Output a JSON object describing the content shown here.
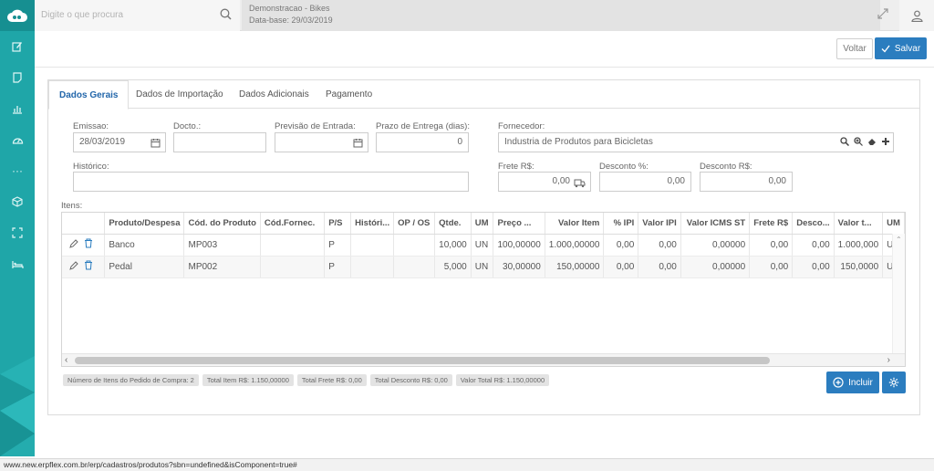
{
  "header": {
    "search_placeholder": "Digite o que procura",
    "company_name": "Demonstracao - Bikes",
    "base_date": "Data-base: 29/03/2019"
  },
  "sidebar": {
    "icons": [
      "edit-icon",
      "note-icon",
      "chart-icon",
      "dashboard-icon",
      "more-icon",
      "box-icon",
      "expand-icon",
      "bed-icon"
    ],
    "more_glyph": "···"
  },
  "actions": {
    "back_label": "Voltar",
    "save_label": "Salvar"
  },
  "tabs": [
    {
      "label": "Dados Gerais",
      "active": true
    },
    {
      "label": "Dados de Importação",
      "active": false
    },
    {
      "label": "Dados Adicionais",
      "active": false
    },
    {
      "label": "Pagamento",
      "active": false
    }
  ],
  "form": {
    "emissao_label": "Emissao:",
    "emissao_value": "28/03/2019",
    "docto_label": "Docto.:",
    "docto_value": "",
    "previsao_label": "Previsão de Entrada:",
    "previsao_value": "",
    "prazo_label": "Prazo de Entrega (dias):",
    "prazo_value": "0",
    "fornecedor_label": "Fornecedor:",
    "fornecedor_value": "Industria de Produtos para Bicicletas",
    "historico_label": "Histórico:",
    "historico_value": "",
    "frete_label": "Frete R$:",
    "frete_value": "0,00",
    "desconto_pct_label": "Desconto %:",
    "desconto_pct_value": "0,00",
    "desconto_rs_label": "Desconto R$:",
    "desconto_rs_value": "0,00"
  },
  "items": {
    "label": "Itens:",
    "columns": [
      "Produto/Despesa",
      "Cód. do Produto",
      "Cód.Fornec.",
      "P/S",
      "Históri...",
      "OP / OS",
      "Qtde.",
      "UM",
      "Preço ...",
      "Valor Item",
      "% IPI",
      "Valor IPI",
      "Valor ICMS ST",
      "Frete R$",
      "Desco...",
      "Valor t...",
      "UM"
    ],
    "rows": [
      [
        "Banco",
        "MP003",
        "",
        "P",
        "",
        "",
        "10,000",
        "UN",
        "100,00000",
        "1.000,00000",
        "0,00",
        "0,00",
        "0,00000",
        "0,00",
        "0,00",
        "1.000,000",
        "UN"
      ],
      [
        "Pedal",
        "MP002",
        "",
        "P",
        "",
        "",
        "5,000",
        "UN",
        "30,00000",
        "150,00000",
        "0,00",
        "0,00",
        "0,00000",
        "0,00",
        "0,00",
        "150,0000",
        "UN"
      ]
    ]
  },
  "summary": [
    "Número de Itens do Pedido de Compra: 2",
    "Total Item R$: 1.150,00000",
    "Total Frete R$: 0,00",
    "Total Desconto R$: 0,00",
    "Valor Total R$: 1.150,00000"
  ],
  "buttons": {
    "include_label": "Incluir"
  },
  "statusbar": {
    "url": "www.new.erpflex.com.br/erp/cadastros/produtos?sbn=undefined&isComponent=true#"
  },
  "colors": {
    "sidebar": "#1fa6a8",
    "primary": "#2b7dbf",
    "active_tab": "#2266aa"
  }
}
